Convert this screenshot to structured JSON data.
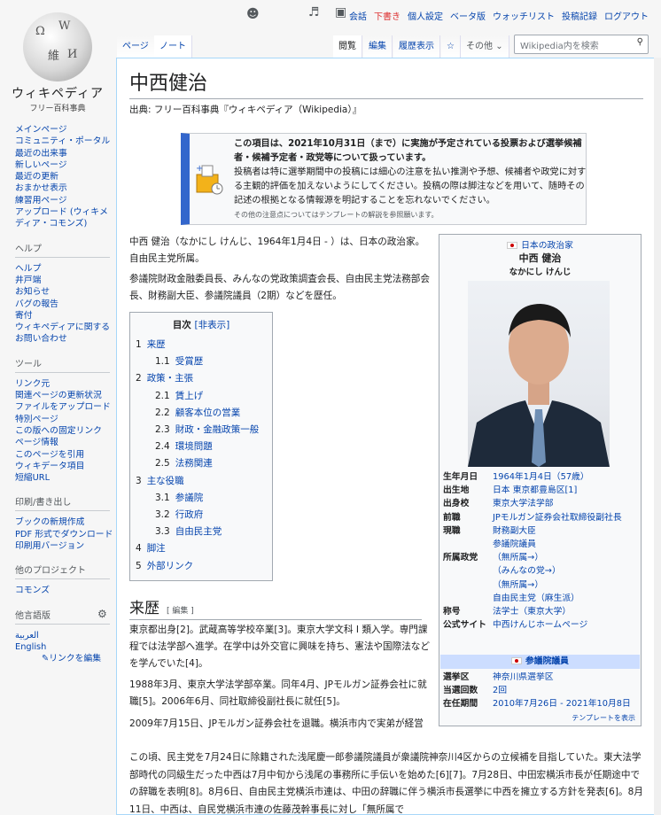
{
  "logo": {
    "wordmark": "ウィキペディア",
    "tagline": "フリー百科事典"
  },
  "personal": [
    "会話",
    "下書き",
    "個人設定",
    "ベータ版",
    "ウォッチリスト",
    "投稿記録",
    "ログアウト"
  ],
  "tabs_left": [
    "ページ",
    "ノート"
  ],
  "tabs_right": [
    "閲覧",
    "編集",
    "履歴表示",
    "その他"
  ],
  "search": {
    "placeholder": "Wikipedia内を検索"
  },
  "sidebar": {
    "main": [
      "メインページ",
      "コミュニティ・ポータル",
      "最近の出来事",
      "新しいページ",
      "最近の更新",
      "おまかせ表示",
      "練習用ページ",
      "アップロード (ウィキメディア・コモンズ)"
    ],
    "help_h": "ヘルプ",
    "help": [
      "ヘルプ",
      "井戸端",
      "お知らせ",
      "バグの報告",
      "寄付",
      "ウィキペディアに関するお問い合わせ"
    ],
    "tools_h": "ツール",
    "tools": [
      "リンク元",
      "関連ページの更新状況",
      "ファイルをアップロード",
      "特別ページ",
      "この版への固定リンク",
      "ページ情報",
      "このページを引用",
      "ウィキデータ項目",
      "短縮URL"
    ],
    "print_h": "印刷/書き出し",
    "print": [
      "ブックの新規作成",
      "PDF 形式でダウンロード",
      "印刷用バージョン"
    ],
    "other_h": "他のプロジェクト",
    "other": [
      "コモンズ"
    ],
    "lang_h": "他言語版",
    "langs": [
      "العربية",
      "English"
    ],
    "edit_links": "リンクを編集"
  },
  "title": "中西健治",
  "subtitle": "出典: フリー百科事典『ウィキペディア（Wikipedia）』",
  "notice": {
    "l1": "この項目は、2021年10月31日（まで）に実施が予定されている投票および選挙候補者・候補予定者・政党等について扱っています。",
    "l2": "投稿者は特に選挙期間中の投稿には細心の注意を払い推測や予想、候補者や政党に対する主観的評価を加えないようにしてください。投稿の際は脚注などを用いて、随時その記述の根拠となる情報源を明記することを忘れないでください。",
    "l3": "その他の注意点についてはテンプレートの解説を参照願います。"
  },
  "intro1": "中西 健治（なかにし けんじ、1964年1月4日 - ）は、日本の政治家。自由民主党所属。",
  "intro2": "参議院財政金融委員長、みんなの党政策調査会長、自由民主党法務部会長、財務副大臣、参議院議員（2期）などを歴任。",
  "toc": {
    "title": "目次",
    "toggle": "[非表示]",
    "items": [
      {
        "n": "1",
        "t": "来歴",
        "l": 1
      },
      {
        "n": "1.1",
        "t": "受賞歴",
        "l": 2
      },
      {
        "n": "2",
        "t": "政策・主張",
        "l": 1
      },
      {
        "n": "2.1",
        "t": "賃上げ",
        "l": 2
      },
      {
        "n": "2.2",
        "t": "顧客本位の営業",
        "l": 2
      },
      {
        "n": "2.3",
        "t": "財政・金融政策一般",
        "l": 2
      },
      {
        "n": "2.4",
        "t": "環境問題",
        "l": 2
      },
      {
        "n": "2.5",
        "t": "法務関連",
        "l": 2
      },
      {
        "n": "3",
        "t": "主な役職",
        "l": 1
      },
      {
        "n": "3.1",
        "t": "参議院",
        "l": 2
      },
      {
        "n": "3.2",
        "t": "行政府",
        "l": 2
      },
      {
        "n": "3.3",
        "t": "自由民主党",
        "l": 2
      },
      {
        "n": "4",
        "t": "脚注",
        "l": 1
      },
      {
        "n": "5",
        "t": "外部リンク",
        "l": 1
      }
    ]
  },
  "infobox": {
    "head": "日本の政治家",
    "name": "中西 健治",
    "kana": "なかにし けんじ",
    "rows": [
      {
        "k": "生年月日",
        "v": "1964年1月4日（57歳）"
      },
      {
        "k": "出生地",
        "v": "日本 東京都豊島区[1]"
      },
      {
        "k": "出身校",
        "v": "東京大学法学部"
      },
      {
        "k": "前職",
        "v": "JPモルガン証券会社取締役副社長"
      },
      {
        "k": "現職",
        "v": "財務副大臣"
      },
      {
        "k": "",
        "v": "参議院議員"
      },
      {
        "k": "所属政党",
        "v": "（無所属→）"
      },
      {
        "k": "",
        "v": "（みんなの党→）"
      },
      {
        "k": "",
        "v": "（無所属→）"
      },
      {
        "k": "",
        "v": "自由民主党（麻生派）"
      },
      {
        "k": "称号",
        "v": "法学士（東京大学）"
      },
      {
        "k": "公式サイト",
        "v": "中西けんじホームページ"
      }
    ],
    "band": "参議院議員",
    "rows2": [
      {
        "k": "選挙区",
        "v": "神奈川県選挙区"
      },
      {
        "k": "当選回数",
        "v": "2回"
      },
      {
        "k": "在任期間",
        "v": "2010年7月26日 - 2021年10月8日"
      }
    ],
    "foot": "テンプレートを表示"
  },
  "h2": {
    "text": "来歴",
    "edit": "[ 編集 ]"
  },
  "p1": "東京都出身[2]。武蔵高等学校卒業[3]。東京大学文科 I 類入学。専門課程では法学部へ進学。在学中は外交官に興味を持ち、憲法や国際法などを学んでいた[4]。",
  "p2": "1988年3月、東京大学法学部卒業。同年4月、JPモルガン証券会社に就職[5]。2006年6月、同社取締役副社長に就任[5]。",
  "p3": "2009年7月15日、JPモルガン証券会社を退職。横浜市内で実弟が経営する環境コンサルティング会社の顧問となる[6]。",
  "p4": "この頃、民主党を7月24日に除籍された浅尾慶一郎参議院議員が衆議院神奈川4区からの立候補を目指していた。東大法学部時代の同級生だった中西は7月中旬から浅尾の事務所に手伝いを始めた[6][7]。7月28日、中田宏横浜市長が任期途中での辞職を表明[8]。8月6日、自由民主党横浜市連は、中田の辞職に伴う横浜市長選挙に中西を擁立する方針を発表[6]。8月11日、中西は、自民党横浜市連の佐藤茂幹事長に対し「無所属で"
}
